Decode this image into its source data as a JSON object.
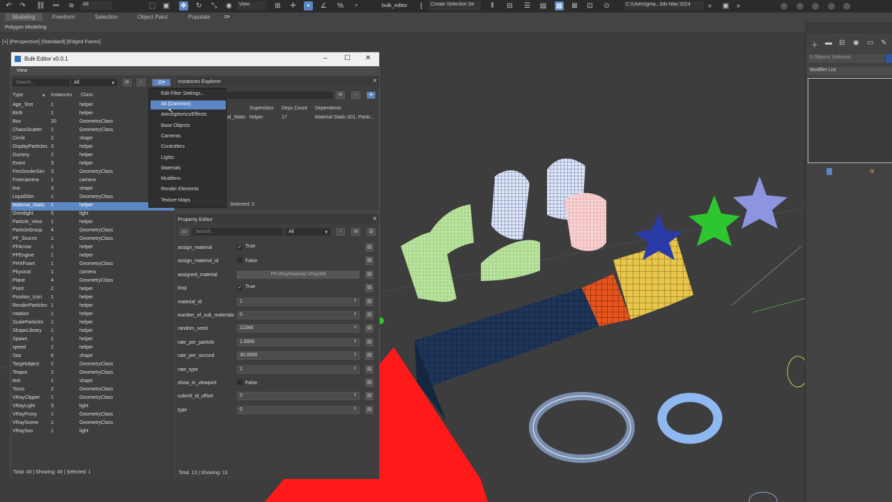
{
  "topbar": {
    "icons": [
      "undo-icon",
      "redo-icon",
      "link-icon",
      "unlink-icon",
      "bind-icon"
    ],
    "filter_value": "All",
    "view_value": "View",
    "named_selection": "bulk_editor",
    "create_selection": "Create Selection Se",
    "path": "C:\\Users\\gma...3ds Max 2024"
  },
  "ribbon_tabs": [
    "Modeling",
    "Freeform",
    "Selection",
    "Object Paint",
    "Populate"
  ],
  "subribbon_label": "Polygon Modeling",
  "viewport_label": "[+] [Perspective] [Standard] [Edged Faces]",
  "cmd_panel": {
    "objects_selected": "0 Objects Selected",
    "modifier_list": "Modifier List"
  },
  "window": {
    "title": "Bulk Editor v0.0.1",
    "menu_view": "View"
  },
  "left": {
    "search_placeholder": "Search...",
    "filter": "All",
    "headers": {
      "type": "Type",
      "instances": "Instances",
      "class": "Class"
    },
    "rows": [
      [
        "Age_Test",
        "1",
        "helper"
      ],
      [
        "Birth",
        "1",
        "helper"
      ],
      [
        "Box",
        "20",
        "GeometryClass"
      ],
      [
        "ChaosScatter",
        "1",
        "GeometryClass"
      ],
      [
        "Circle",
        "2",
        "shape"
      ],
      [
        "DisplayParticles",
        "3",
        "helper"
      ],
      [
        "Dummy",
        "2",
        "helper"
      ],
      [
        "Event",
        "3",
        "helper"
      ],
      [
        "FireSmokeSim",
        "3",
        "GeometryClass"
      ],
      [
        "Freecamera",
        "1",
        "camera"
      ],
      [
        "line",
        "3",
        "shape"
      ],
      [
        "LiquidSim",
        "1",
        "GeometryClass"
      ],
      [
        "Material_Static",
        "1",
        "helper"
      ],
      [
        "Omnilight",
        "5",
        "light"
      ],
      [
        "Particle_View",
        "1",
        "helper"
      ],
      [
        "ParticleGroup",
        "4",
        "GeometryClass"
      ],
      [
        "PF_Source",
        "1",
        "GeometryClass"
      ],
      [
        "PFArrow",
        "1",
        "helper"
      ],
      [
        "PFEngine",
        "1",
        "helper"
      ],
      [
        "PHXFoam",
        "1",
        "GeometryClass"
      ],
      [
        "Physical",
        "1",
        "camera"
      ],
      [
        "Plane",
        "4",
        "GeometryClass"
      ],
      [
        "Point",
        "2",
        "helper"
      ],
      [
        "Position_Icon",
        "1",
        "helper"
      ],
      [
        "RenderParticles",
        "1",
        "helper"
      ],
      [
        "rotation",
        "1",
        "helper"
      ],
      [
        "ScaleParticles",
        "1",
        "helper"
      ],
      [
        "ShapeLibrary",
        "1",
        "helper"
      ],
      [
        "Spawn",
        "1",
        "helper"
      ],
      [
        "speed",
        "2",
        "helper"
      ],
      [
        "Star",
        "6",
        "shape"
      ],
      [
        "Targetobject",
        "2",
        "GeometryClass"
      ],
      [
        "Teapot",
        "2",
        "GeometryClass"
      ],
      [
        "text",
        "1",
        "shape"
      ],
      [
        "Torus",
        "2",
        "GeometryClass"
      ],
      [
        "VRayClipper",
        "1",
        "GeometryClass"
      ],
      [
        "VRayLight",
        "3",
        "light"
      ],
      [
        "VRayProxy",
        "1",
        "GeometryClass"
      ],
      [
        "VRayScene",
        "1",
        "GeometryClass"
      ],
      [
        "VRaySun",
        "1",
        "light"
      ]
    ],
    "selected_index": 12,
    "status": "Total: 40 | Showing: 40 | Selected: 1"
  },
  "instances": {
    "title": "Instances Explorer",
    "headers": {
      "superclass": "Superclass",
      "deps": "Deps Count",
      "dependents": "Dependents"
    },
    "row": {
      "name": "al_Static",
      "superclass": "helper",
      "deps": "17",
      "dependents": "Material Static 001, Partic..."
    },
    "status": "Selected: 0"
  },
  "filter_menu": {
    "items": [
      "Edit Filter Settings...",
      "All (Common)",
      "Atmospherics/Effects",
      "Base Objects",
      "Cameras",
      "Controllers",
      "Lights",
      "Materials",
      "Modifiers",
      "Render Elements",
      "Texture Maps"
    ],
    "selected_index": 1
  },
  "property": {
    "title": "Property Editor",
    "search_placeholder": "Search...",
    "filter": "All",
    "rows": [
      {
        "label": "assign_material",
        "kind": "check",
        "checked": true,
        "value": "True"
      },
      {
        "label": "assign_material_id",
        "kind": "check",
        "checked": false,
        "value": "False"
      },
      {
        "label": "assigned_material",
        "kind": "ro",
        "value": "PFVRayMaterial:VRayMtl"
      },
      {
        "label": "loop",
        "kind": "check",
        "checked": true,
        "value": "True"
      },
      {
        "label": "material_id",
        "kind": "spin",
        "value": "1"
      },
      {
        "label": "number_of_sub_materials",
        "kind": "spin",
        "value": "0"
      },
      {
        "label": "random_seed",
        "kind": "spin",
        "value": "12345"
      },
      {
        "label": "rate_per_particle",
        "kind": "spin",
        "value": "1.0000"
      },
      {
        "label": "rate_per_second",
        "kind": "spin",
        "value": "30.0000"
      },
      {
        "label": "rate_type",
        "kind": "spin",
        "value": "1"
      },
      {
        "label": "show_in_viewport",
        "kind": "check",
        "checked": false,
        "value": "False"
      },
      {
        "label": "submtl_id_offset",
        "kind": "spin",
        "value": "0"
      },
      {
        "label": "type",
        "kind": "spin",
        "value": "0"
      }
    ],
    "status": "Total: 13 | Showing: 13"
  },
  "colors": {
    "accent": "#5b87c5",
    "red": "#ff1a1a",
    "navy": "#1e3559",
    "orange": "#e8541d",
    "yellow": "#e8c64c",
    "green": "#2ec62e",
    "star_blue": "#2a3ba8",
    "star_lilac": "#8e95e0"
  }
}
